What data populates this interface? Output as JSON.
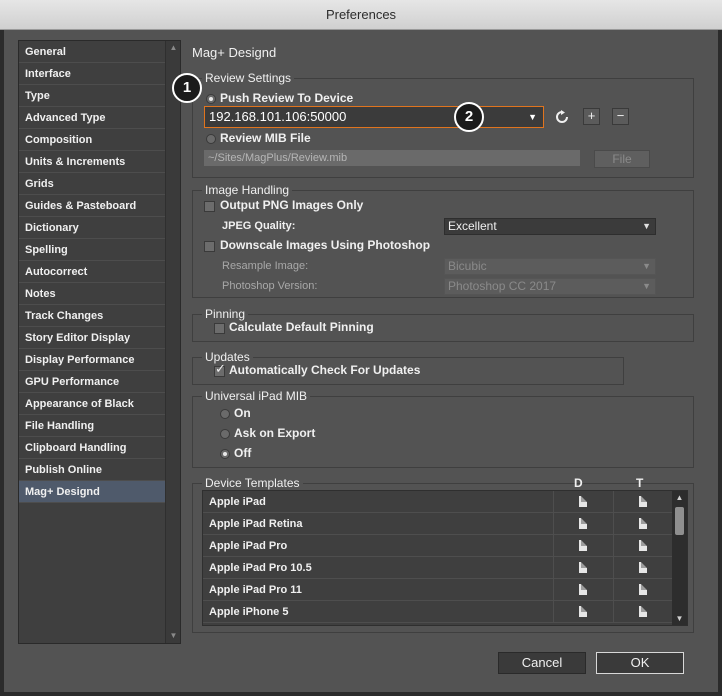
{
  "window": {
    "title": "Preferences"
  },
  "sidebar": {
    "items": [
      {
        "label": "General"
      },
      {
        "label": "Interface"
      },
      {
        "label": "Type"
      },
      {
        "label": "Advanced Type"
      },
      {
        "label": "Composition"
      },
      {
        "label": "Units & Increments"
      },
      {
        "label": "Grids"
      },
      {
        "label": "Guides & Pasteboard"
      },
      {
        "label": "Dictionary"
      },
      {
        "label": "Spelling"
      },
      {
        "label": "Autocorrect"
      },
      {
        "label": "Notes"
      },
      {
        "label": "Track Changes"
      },
      {
        "label": "Story Editor Display"
      },
      {
        "label": "Display Performance"
      },
      {
        "label": "GPU Performance"
      },
      {
        "label": "Appearance of Black"
      },
      {
        "label": "File Handling"
      },
      {
        "label": "Clipboard Handling"
      },
      {
        "label": "Publish Online"
      },
      {
        "label": "Mag+ Designd"
      }
    ],
    "selected": "Mag+ Designd"
  },
  "panel": {
    "title": "Mag+ Designd"
  },
  "review": {
    "group_title": "Review Settings",
    "push_label": "Push Review To Device",
    "ip_value": "192.168.101.106:50000",
    "mib_label": "Review MIB File",
    "mib_path": "~/Sites/MagPlus/Review.mib",
    "file_button": "File",
    "plus": "+",
    "minus": "−"
  },
  "callouts": {
    "one": "1",
    "two": "2"
  },
  "image_handling": {
    "group_title": "Image Handling",
    "png_only_label": "Output PNG Images Only",
    "jpeg_quality_label": "JPEG Quality:",
    "jpeg_quality_value": "Excellent",
    "downscale_label": "Downscale Images Using Photoshop",
    "resample_label": "Resample Image:",
    "resample_value": "Bicubic",
    "ps_version_label": "Photoshop Version:",
    "ps_version_value": "Photoshop CC 2017"
  },
  "pinning": {
    "group_title": "Pinning",
    "calc_label": "Calculate Default Pinning"
  },
  "updates": {
    "group_title": "Updates",
    "auto_label": "Automatically Check For Updates"
  },
  "universal": {
    "group_title": "Universal iPad MIB",
    "on_label": "On",
    "ask_label": "Ask on Export",
    "off_label": "Off"
  },
  "device_templates": {
    "group_title": "Device Templates",
    "col_d": "D",
    "col_t": "T",
    "rows": [
      {
        "name": "Apple iPad"
      },
      {
        "name": "Apple iPad Retina"
      },
      {
        "name": "Apple iPad Pro"
      },
      {
        "name": "Apple iPad Pro 10.5"
      },
      {
        "name": "Apple iPad Pro 11"
      },
      {
        "name": "Apple iPhone 5"
      }
    ]
  },
  "footer": {
    "cancel": "Cancel",
    "ok": "OK"
  },
  "colors": {
    "accent_focus": "#e0741e",
    "selection": "#4f5a6b"
  }
}
